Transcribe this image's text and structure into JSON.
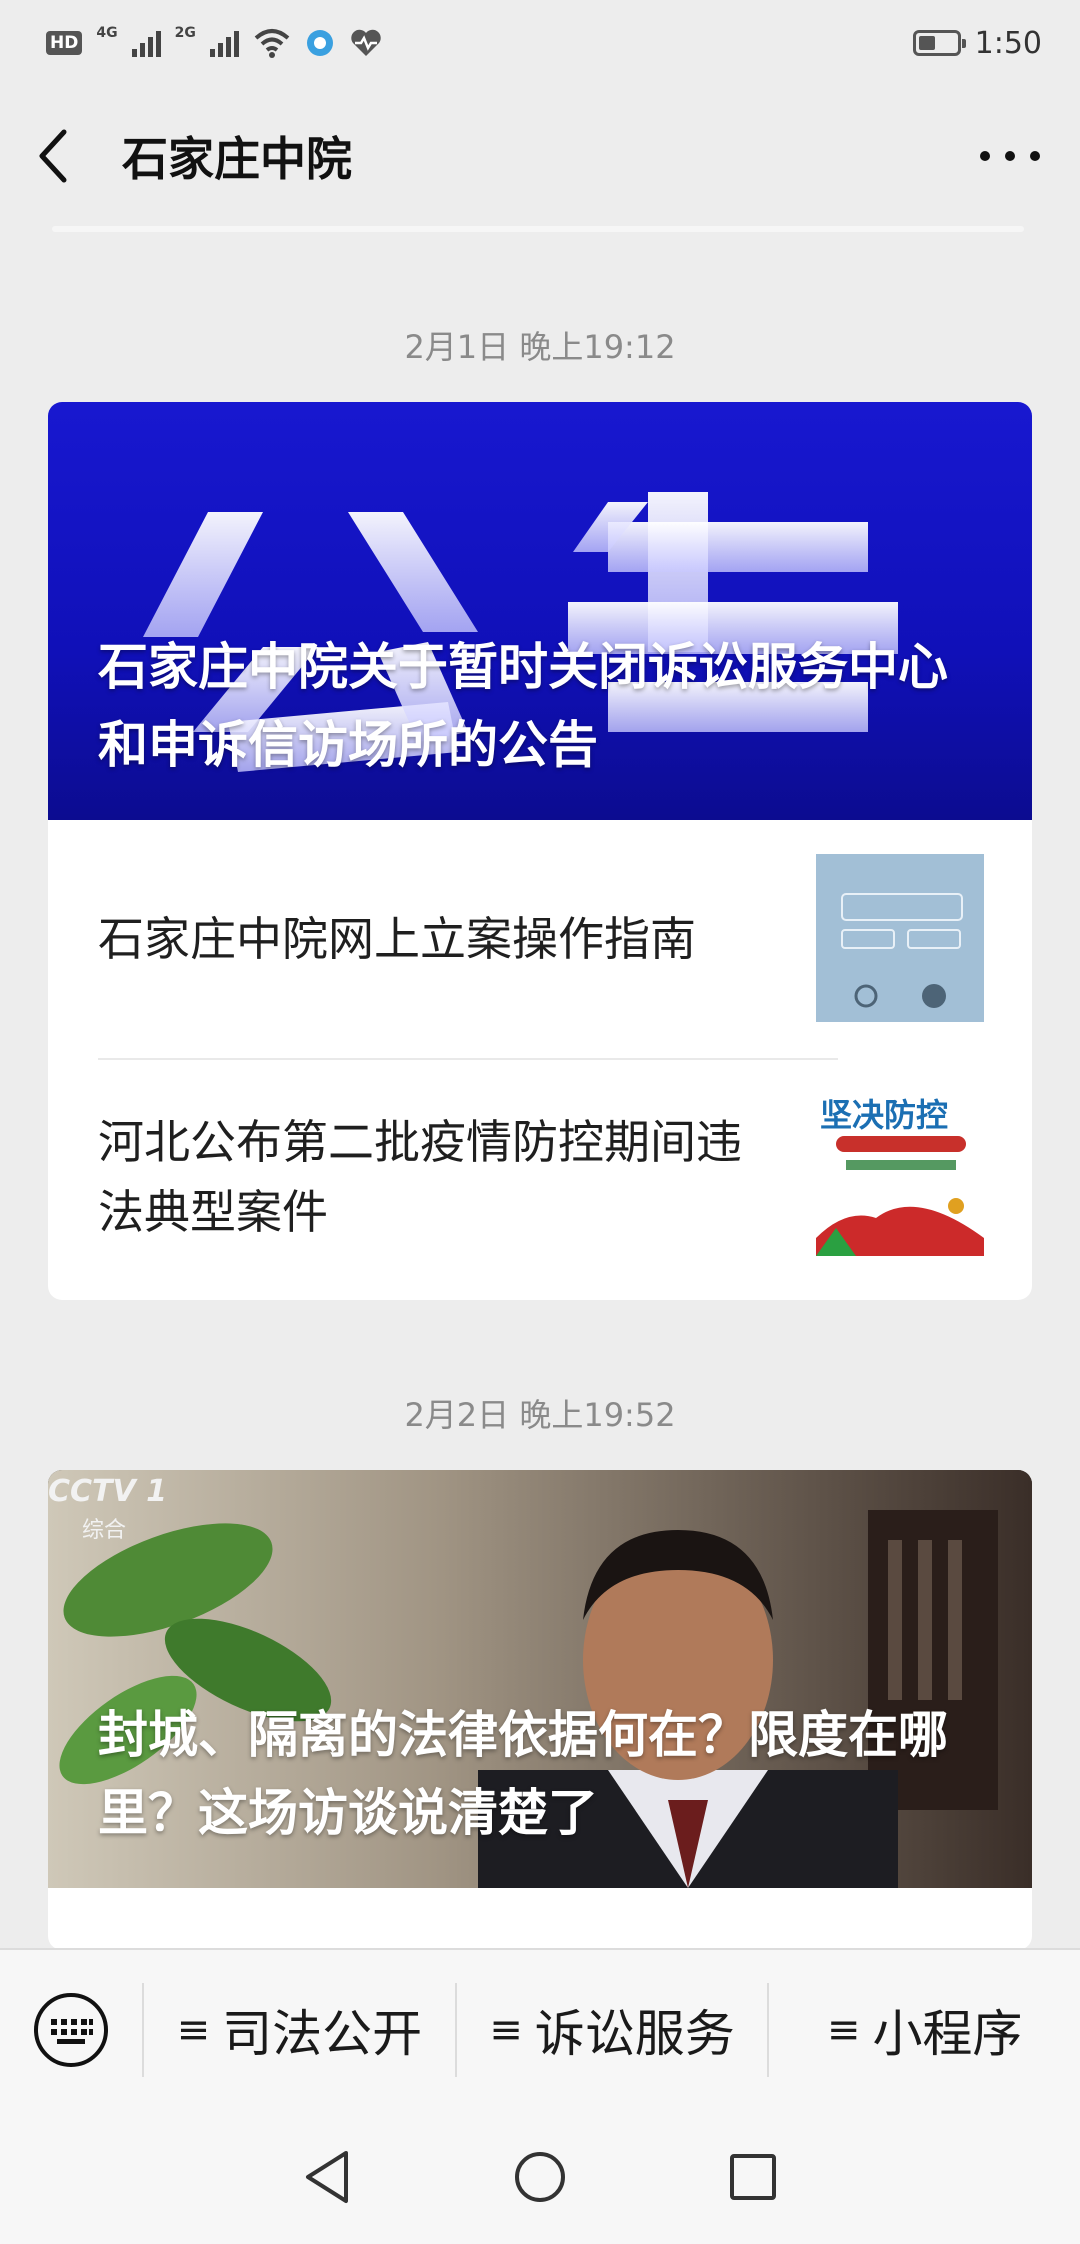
{
  "status_bar": {
    "left_badges": [
      "HD",
      "4G",
      "2G"
    ],
    "time": "1:50",
    "battery_level": 0.45
  },
  "nav": {
    "title": "石家庄中院"
  },
  "feed": [
    {
      "timestamp": "2月1日 晚上19:12",
      "hero": {
        "title": "石家庄中院关于暂时关闭诉讼服务中心和申诉信访场所的公告",
        "background_text": "公 告"
      },
      "items": [
        {
          "title": "石家庄中院网上立案操作指南"
        },
        {
          "title": "河北公布第二批疫情防控期间违法典型案件",
          "thumb_caption": "坚决防控"
        }
      ]
    },
    {
      "timestamp": "2月2日 晚上19:52",
      "hero": {
        "title": "封城、隔离的法律依据何在？限度在哪里？这场访谈说清楚了",
        "logo_text": "CCTV 1",
        "logo_sub": "综合"
      }
    }
  ],
  "menu": {
    "items": [
      {
        "glyph": "≡",
        "label": "司法公开"
      },
      {
        "glyph": "≡",
        "label": "诉讼服务"
      },
      {
        "glyph": "≡",
        "label": "小程序"
      }
    ]
  },
  "colors": {
    "hero_blue": "#1414c8",
    "page_bg": "#ededed"
  }
}
